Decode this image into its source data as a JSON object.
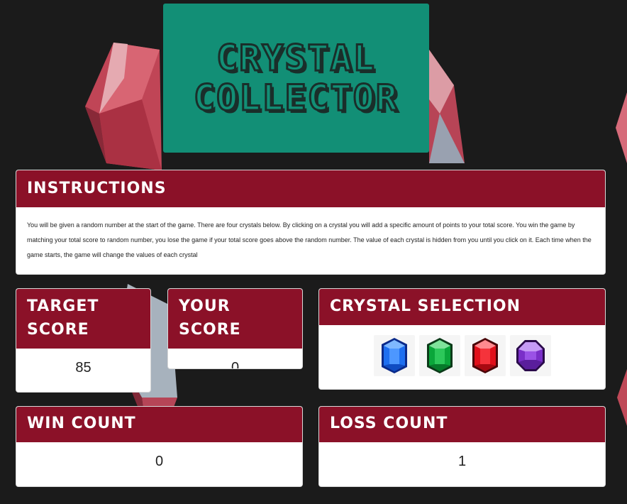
{
  "title": {
    "line1": "CRYSTAL",
    "line2": "COLLECTOR"
  },
  "instructions": {
    "heading": "INSTRUCTIONS",
    "text": "You will be given a random number at the start of the game. There are four crystals below. By clicking on a crystal you will add a specific amount of points to your total score. You win the game by matching your total score to random number, you lose the game if your total score goes above the random number. The value of each crystal is hidden from you until you click on it. Each time when the game starts, the game will change the values of each crystal"
  },
  "target": {
    "heading": "TARGET SCORE",
    "value": "85"
  },
  "your_score": {
    "heading": "YOUR SCORE",
    "value": "0"
  },
  "crystal_selection": {
    "heading": "CRYSTAL SELECTION",
    "crystals": [
      {
        "icon": "blue-crystal-icon",
        "color": "#1e6ff0"
      },
      {
        "icon": "green-crystal-icon",
        "color": "#0aa63a"
      },
      {
        "icon": "red-crystal-icon",
        "color": "#e0101a"
      },
      {
        "icon": "purple-crystal-icon",
        "color": "#7a2fc8"
      }
    ]
  },
  "win_count": {
    "heading": "WIN COUNT",
    "value": "0"
  },
  "loss_count": {
    "heading": "LOSS COUNT",
    "value": "1"
  },
  "colors": {
    "background": "#1b1b1b",
    "title_box": "#128f76",
    "panel_header": "#8b1128"
  }
}
